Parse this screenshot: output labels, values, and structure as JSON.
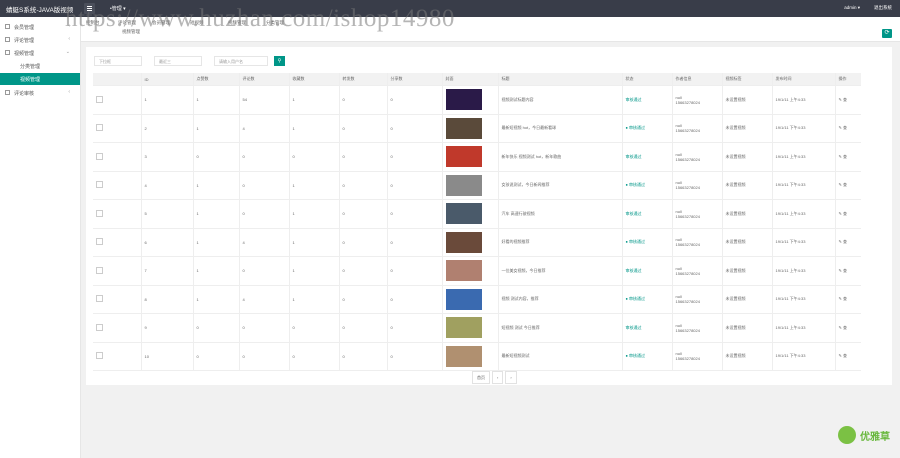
{
  "header": {
    "logo": "蜻蜓S系统-JAVA版视频",
    "menu_label": "•管理 ▾",
    "user": "admin ▾",
    "logout": "退出系统"
  },
  "tabs": {
    "items": [
      "控制台",
      "评论管理",
      "会员管理",
      "短视频",
      "视频管理",
      "分类管理"
    ],
    "sub": "视频管理"
  },
  "sidebar": {
    "items": [
      {
        "label": "会员管理",
        "arrow": "‹"
      },
      {
        "label": "评论管理",
        "arrow": "‹"
      },
      {
        "label": "视频管理",
        "arrow": "⌄"
      },
      {
        "label": "分类管理",
        "arrow": ""
      },
      {
        "label": "视频管理",
        "arrow": ""
      },
      {
        "label": "评论审核",
        "arrow": "‹"
      }
    ]
  },
  "search": {
    "p1": "下拉框",
    "p2": "最近三",
    "p3": "请输入用户名",
    "button_icon": "search-icon"
  },
  "table": {
    "headers": [
      "",
      "ID",
      "点赞数",
      "评论数",
      "收藏数",
      "转发数",
      "分享数",
      "封面",
      "标题",
      "状态",
      "作者信息",
      "视频标签",
      "发布时间",
      "操作"
    ],
    "rows": [
      {
        "id": "1",
        "c1": "1",
        "c2": "54",
        "c3": "1",
        "c4": "0",
        "c5": "0",
        "title": "视频测试标题内容",
        "status": "审核通过",
        "author": "null\n15663278024",
        "tag": "未设置视频",
        "time": "19/1/11 上午4:33",
        "op": "✎ 查"
      },
      {
        "id": "2",
        "c1": "1",
        "c2": "4",
        "c3": "1",
        "c4": "0",
        "c5": "0",
        "title": "最新短视频 hot，今日最新看球",
        "status": "● 审核通过",
        "author": "null\n15663278024",
        "tag": "未设置视频",
        "time": "19/1/11 下午4:33",
        "op": "✎ 查"
      },
      {
        "id": "3",
        "c1": "0",
        "c2": "0",
        "c3": "0",
        "c4": "0",
        "c5": "0",
        "title": "新年快乐 视频测试 hot，新年歌曲",
        "status": "审核通过",
        "author": "null\n15663278024",
        "tag": "未设置视频",
        "time": "19/1/11 上午4:33",
        "op": "✎ 查"
      },
      {
        "id": "4",
        "c1": "1",
        "c2": "0",
        "c3": "1",
        "c4": "0",
        "c5": "0",
        "title": "女孩说测试，今日新闻推荐",
        "status": "● 审核通过",
        "author": "null\n15663278024",
        "tag": "未设置视频",
        "time": "19/1/11 下午4:33",
        "op": "✎ 查"
      },
      {
        "id": "5",
        "c1": "1",
        "c2": "0",
        "c3": "1",
        "c4": "0",
        "c5": "0",
        "title": "汽车 高速行驶视频",
        "status": "审核通过",
        "author": "null\n15663278024",
        "tag": "未设置视频",
        "time": "19/1/11 上午4:33",
        "op": "✎ 查"
      },
      {
        "id": "6",
        "c1": "1",
        "c2": "4",
        "c3": "1",
        "c4": "0",
        "c5": "0",
        "title": "好看的视频推荐",
        "status": "● 审核通过",
        "author": "null\n15663278024",
        "tag": "未设置视频",
        "time": "19/1/11 下午4:33",
        "op": "✎ 查"
      },
      {
        "id": "7",
        "c1": "1",
        "c2": "0",
        "c3": "1",
        "c4": "0",
        "c5": "0",
        "title": "一位美女视频，今日推荐",
        "status": "审核通过",
        "author": "null\n15663278024",
        "tag": "未设置视频",
        "time": "19/1/11 上午4:33",
        "op": "✎ 查"
      },
      {
        "id": "8",
        "c1": "1",
        "c2": "4",
        "c3": "1",
        "c4": "0",
        "c5": "0",
        "title": "视频 测试内容，推荐",
        "status": "● 审核通过",
        "author": "null\n15663278024",
        "tag": "未设置视频",
        "time": "19/1/11 下午4:33",
        "op": "✎ 查"
      },
      {
        "id": "9",
        "c1": "0",
        "c2": "0",
        "c3": "0",
        "c4": "0",
        "c5": "0",
        "title": "短视频 测试 今日推荐",
        "status": "审核通过",
        "author": "null\n15663278024",
        "tag": "未设置视频",
        "time": "19/1/11 上午4:33",
        "op": "✎ 查"
      },
      {
        "id": "10",
        "c1": "0",
        "c2": "0",
        "c3": "0",
        "c4": "0",
        "c5": "0",
        "title": "最新短视频测试",
        "status": "● 审核通过",
        "author": "null\n15663278024",
        "tag": "未设置视频",
        "time": "19/1/11 下午4:33",
        "op": "✎ 查"
      }
    ],
    "thumb_colors": [
      "#2a1a48",
      "#5a4a3a",
      "#c0392b",
      "#8a8a8a",
      "#4a5a6a",
      "#6a4a3a",
      "#b08070",
      "#3a6ab0",
      "#a0a060",
      "#b09070"
    ]
  },
  "pager": {
    "first": "首页",
    "prev": "‹",
    "next": "›"
  },
  "watermark": "https://www.huzhan.com/ishop14980",
  "brand": "优雅草"
}
